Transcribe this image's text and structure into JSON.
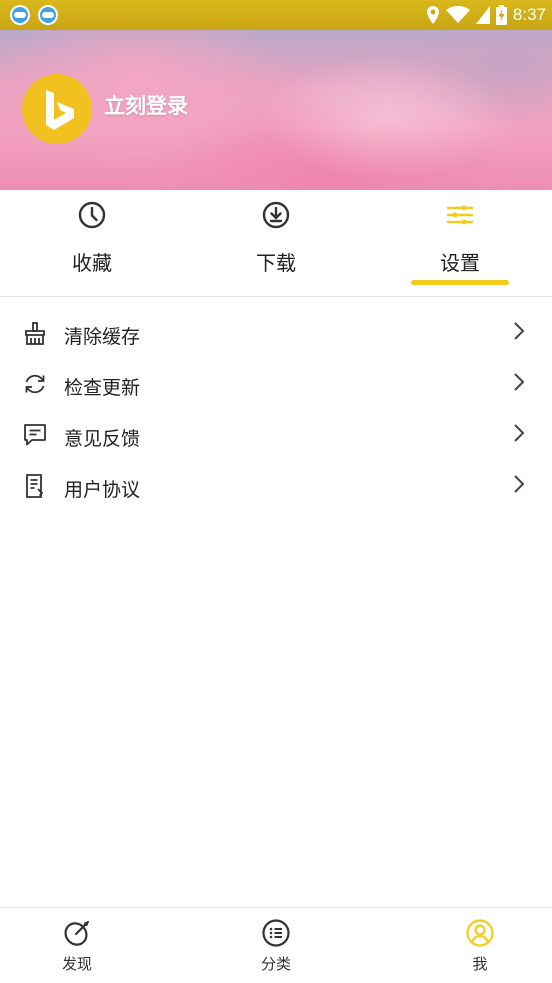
{
  "status_bar": {
    "time": "8:37",
    "icons": [
      "app-notification-icon",
      "app-notification-icon",
      "location-icon",
      "wifi-icon",
      "signal-icon",
      "battery-charging-icon"
    ]
  },
  "header": {
    "login_text": "立刻登录",
    "avatar_icon": "bing-logo-icon"
  },
  "tabs": [
    {
      "label": "收藏",
      "icon": "clock-icon",
      "active": false
    },
    {
      "label": "下载",
      "icon": "download-icon",
      "active": false
    },
    {
      "label": "设置",
      "icon": "sliders-icon",
      "active": true
    }
  ],
  "settings": [
    {
      "label": "清除缓存",
      "icon": "broom-icon"
    },
    {
      "label": "检查更新",
      "icon": "refresh-icon"
    },
    {
      "label": "意见反馈",
      "icon": "feedback-icon"
    },
    {
      "label": "用户协议",
      "icon": "document-icon"
    }
  ],
  "bottom_nav": [
    {
      "label": "发现",
      "icon": "satellite-dish-icon",
      "active": false
    },
    {
      "label": "分类",
      "icon": "list-icon",
      "active": false
    },
    {
      "label": "我",
      "icon": "user-icon",
      "active": true
    }
  ],
  "colors": {
    "accent": "#f5cc1c",
    "status_bar": "#c9a514",
    "text": "#222222",
    "icon": "#333333"
  }
}
